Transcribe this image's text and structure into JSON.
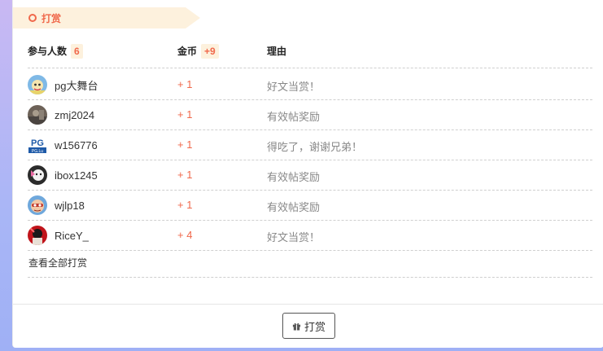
{
  "section": {
    "title": "打赏"
  },
  "header": {
    "participants_label": "参与人数",
    "participants_count": "6",
    "coins_label": "金币",
    "coins_total": "+9",
    "reason_label": "理由"
  },
  "rows": [
    {
      "username": "pg大舞台",
      "coins": "+ 1",
      "reason": "好文当赏！",
      "avatar": "avatar-pg-stage"
    },
    {
      "username": "zmj2024",
      "coins": "+ 1",
      "reason": "有效帖奖励",
      "avatar": "avatar-zmj"
    },
    {
      "username": "w156776",
      "coins": "+ 1",
      "reason": "得吃了，谢谢兄弟！",
      "avatar": "avatar-pg-logo"
    },
    {
      "username": "ibox1245",
      "coins": "+ 1",
      "reason": "有效帖奖励",
      "avatar": "avatar-ibox"
    },
    {
      "username": "wjlp18",
      "coins": "+ 1",
      "reason": "有效帖奖励",
      "avatar": "avatar-wjlp"
    },
    {
      "username": "RiceY_",
      "coins": "+ 4",
      "reason": "好文当赏！",
      "avatar": "avatar-ricey"
    }
  ],
  "view_all": "查看全部打赏",
  "reward_button": {
    "label": "打赏",
    "icon": "gift-icon"
  },
  "colors": {
    "accent": "#f0684b",
    "tag_bg": "#fdf1dd"
  },
  "avatar_logo_text": {
    "top": "PG",
    "bottom": "PG.Lu"
  }
}
